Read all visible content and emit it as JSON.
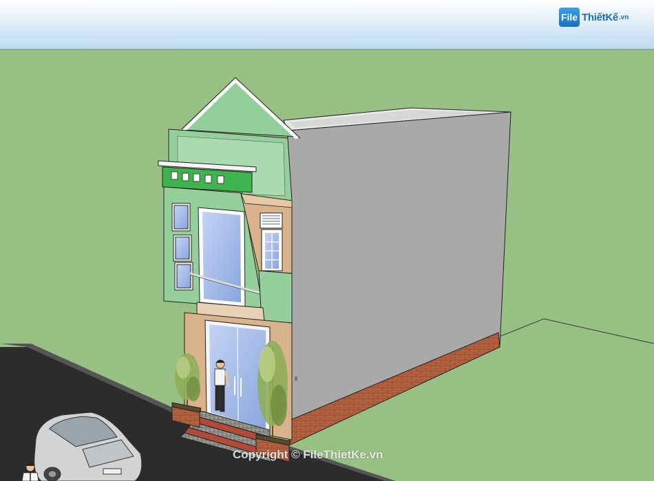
{
  "watermark": {
    "logo_mark": "File",
    "logo_text": "ThiếtKế",
    "logo_suffix": ".vn",
    "copyright": "Copyright © FileThietKe.vn"
  },
  "colors": {
    "sky_top": "#ffffff",
    "sky_bottom": "#bfdcf2",
    "ground": "#98c084",
    "road": "#2b2b2b",
    "facade_green": "#8fcf98",
    "side_wall": "#a8a8a8",
    "brick": "#b15f3c",
    "trim_beige": "#d9b48c",
    "glass": "#9fb7e6"
  }
}
